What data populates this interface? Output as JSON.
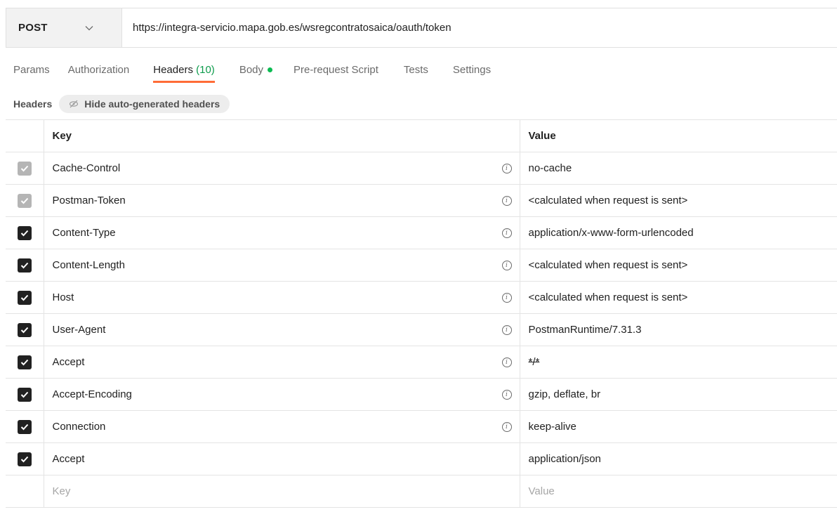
{
  "request": {
    "method": "POST",
    "url": "https://integra-servicio.mapa.gob.es/wsregcontratosaica/oauth/token"
  },
  "tabs": [
    {
      "label": "Params"
    },
    {
      "label": "Authorization"
    },
    {
      "label": "Headers",
      "count": "(10)"
    },
    {
      "label": "Body"
    },
    {
      "label": "Pre-request Script"
    },
    {
      "label": "Tests"
    },
    {
      "label": "Settings"
    }
  ],
  "headers_section": {
    "title": "Headers",
    "toggle_label": "Hide auto-generated headers"
  },
  "table": {
    "columns": {
      "key": "Key",
      "value": "Value"
    },
    "rows": [
      {
        "key": "Cache-Control",
        "value": "no-cache"
      },
      {
        "key": "Postman-Token",
        "value": "<calculated when request is sent>"
      },
      {
        "key": "Content-Type",
        "value": "application/x-www-form-urlencoded"
      },
      {
        "key": "Content-Length",
        "value": "<calculated when request is sent>"
      },
      {
        "key": "Host",
        "value": "<calculated when request is sent>"
      },
      {
        "key": "User-Agent",
        "value": "PostmanRuntime/7.31.3"
      },
      {
        "key": "Accept",
        "value": "*/*"
      },
      {
        "key": "Accept-Encoding",
        "value": "gzip, deflate, br"
      },
      {
        "key": "Connection",
        "value": "keep-alive"
      },
      {
        "key": "Accept",
        "value": "application/json"
      }
    ],
    "new_row": {
      "key_placeholder": "Key",
      "value_placeholder": "Value"
    }
  },
  "colors": {
    "accent": "#ff6c37",
    "count_green": "#0c9b4b",
    "body_dot": "#0cbb52"
  }
}
